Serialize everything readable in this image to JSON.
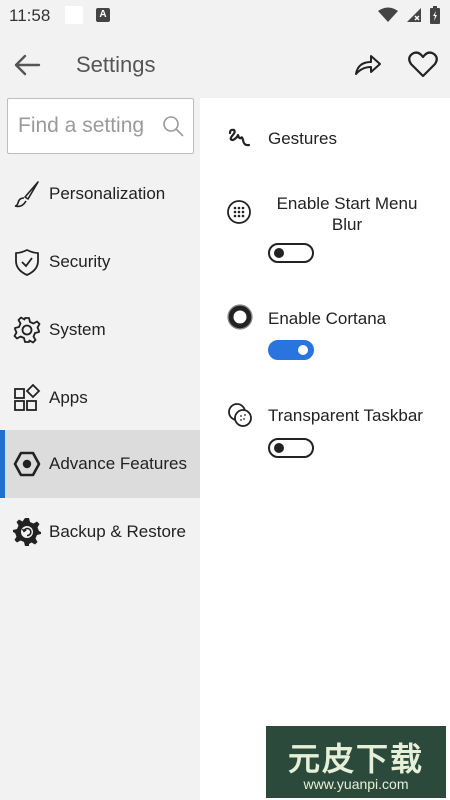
{
  "status_bar": {
    "time": "11:58",
    "icons": [
      "notification-square-icon",
      "a-app-icon",
      "wifi-icon",
      "signal-icon",
      "battery-icon"
    ]
  },
  "header": {
    "title": "Settings",
    "back_icon": "arrow-left-icon",
    "share_icon": "share-icon",
    "favorite_icon": "heart-icon"
  },
  "search": {
    "placeholder": "Find a setting",
    "value": ""
  },
  "sidebar": {
    "items": [
      {
        "label": "Personalization",
        "icon": "brush-icon",
        "active": false
      },
      {
        "label": "Security",
        "icon": "shield-icon",
        "active": false
      },
      {
        "label": "System",
        "icon": "gear-icon",
        "active": false
      },
      {
        "label": "Apps",
        "icon": "apps-grid-icon",
        "active": false
      },
      {
        "label": "Advance Features",
        "icon": "hexagon-icon",
        "active": true
      },
      {
        "label": "Backup & Restore",
        "icon": "backup-gear-icon",
        "active": false
      }
    ]
  },
  "content": {
    "options": [
      {
        "label": "Gestures",
        "icon": "gesture-icon"
      },
      {
        "label": "Enable Start Menu Blur",
        "icon": "dots-circle-icon",
        "toggle_on": false
      },
      {
        "label": "Enable Cortana",
        "icon": "cortana-ring-icon",
        "toggle_on": true
      },
      {
        "label": "Transparent Taskbar",
        "icon": "transparency-icon",
        "toggle_on": false
      }
    ]
  },
  "watermark": {
    "title": "元皮下载",
    "url": "www.yuanpi.com"
  },
  "colors": {
    "accent": "#1f6fd1",
    "toggle_on": "#2a74e0",
    "sidebar_bg": "#f2f2f2",
    "active_item_bg": "#dcdcdc"
  }
}
